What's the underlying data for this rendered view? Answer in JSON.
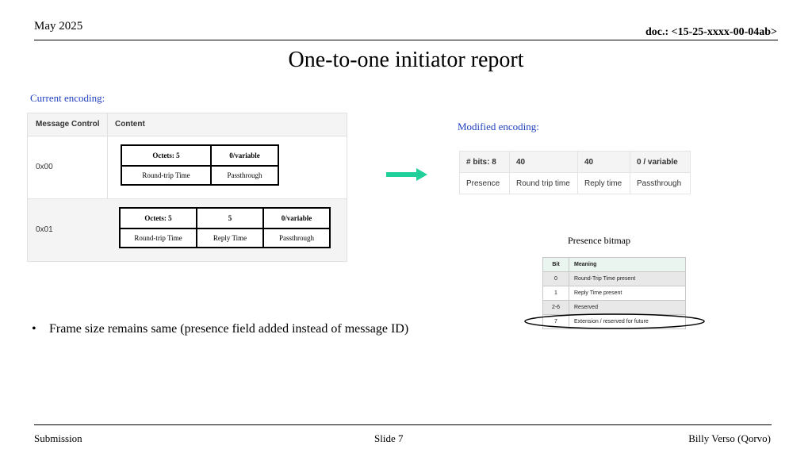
{
  "header": {
    "date": "May 2025",
    "doc_id": "doc.: <15-25-xxxx-00-04ab>",
    "title": "One-to-one initiator report"
  },
  "current_encoding": {
    "label": "Current encoding:",
    "col_headers": [
      "Message Control",
      "Content"
    ],
    "rows": [
      {
        "control": "0x00",
        "content": {
          "top": [
            "Octets: 5",
            "0/variable"
          ],
          "bottom": [
            "Round-trip Time",
            "Passthrough"
          ]
        }
      },
      {
        "control": "0x01",
        "content": {
          "top": [
            "Octets: 5",
            "5",
            "0/variable"
          ],
          "bottom": [
            "Round-trip Time",
            "Reply Time",
            "Passthrough"
          ]
        }
      }
    ]
  },
  "modified_encoding": {
    "label": "Modified encoding:",
    "top": [
      "# bits: 8",
      "40",
      "40",
      "0 / variable"
    ],
    "bottom": [
      "Presence",
      "Round trip time",
      "Reply time",
      "Passthrough"
    ]
  },
  "presence_bitmap": {
    "label": "Presence bitmap",
    "headers": [
      "Bit",
      "Meaning"
    ],
    "rows": [
      [
        "0",
        "Round-Trip Time present"
      ],
      [
        "1",
        "Reply Time present"
      ],
      [
        "2-6",
        "Reserved"
      ],
      [
        "7",
        "Extension / reserved for future"
      ]
    ]
  },
  "bullets": [
    "Frame size remains same (presence field added instead of message ID)"
  ],
  "footer": {
    "left": "Submission",
    "center": "Slide 7",
    "right": "Billy Verso (Qorvo)"
  },
  "colors": {
    "label_blue": "#1f3fbf",
    "arrow_teal": "#1fd09a"
  }
}
